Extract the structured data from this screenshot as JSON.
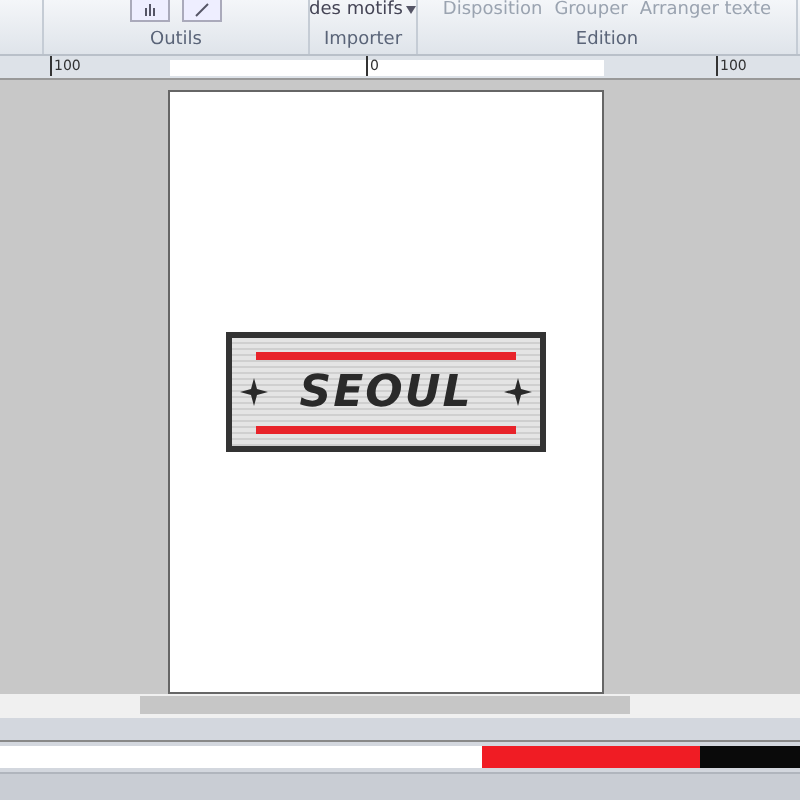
{
  "ribbon": {
    "groups": [
      {
        "label": "Outils",
        "kind": "tools"
      },
      {
        "label": "Importer",
        "kind": "import",
        "button": "des motifs"
      },
      {
        "label": "Edition",
        "kind": "edit",
        "items": [
          {
            "label": "Disposition",
            "disabled": true
          },
          {
            "label": "Grouper",
            "disabled": true
          },
          {
            "label": "Arranger texte",
            "disabled": true
          }
        ]
      }
    ]
  },
  "ruler": {
    "labels": [
      "100",
      "0",
      "100"
    ]
  },
  "design": {
    "text": "SEOUL"
  },
  "thread_colors": [
    {
      "color": "#ffffff"
    },
    {
      "color": "#f01c24"
    },
    {
      "color": "#0a0a0a"
    }
  ]
}
